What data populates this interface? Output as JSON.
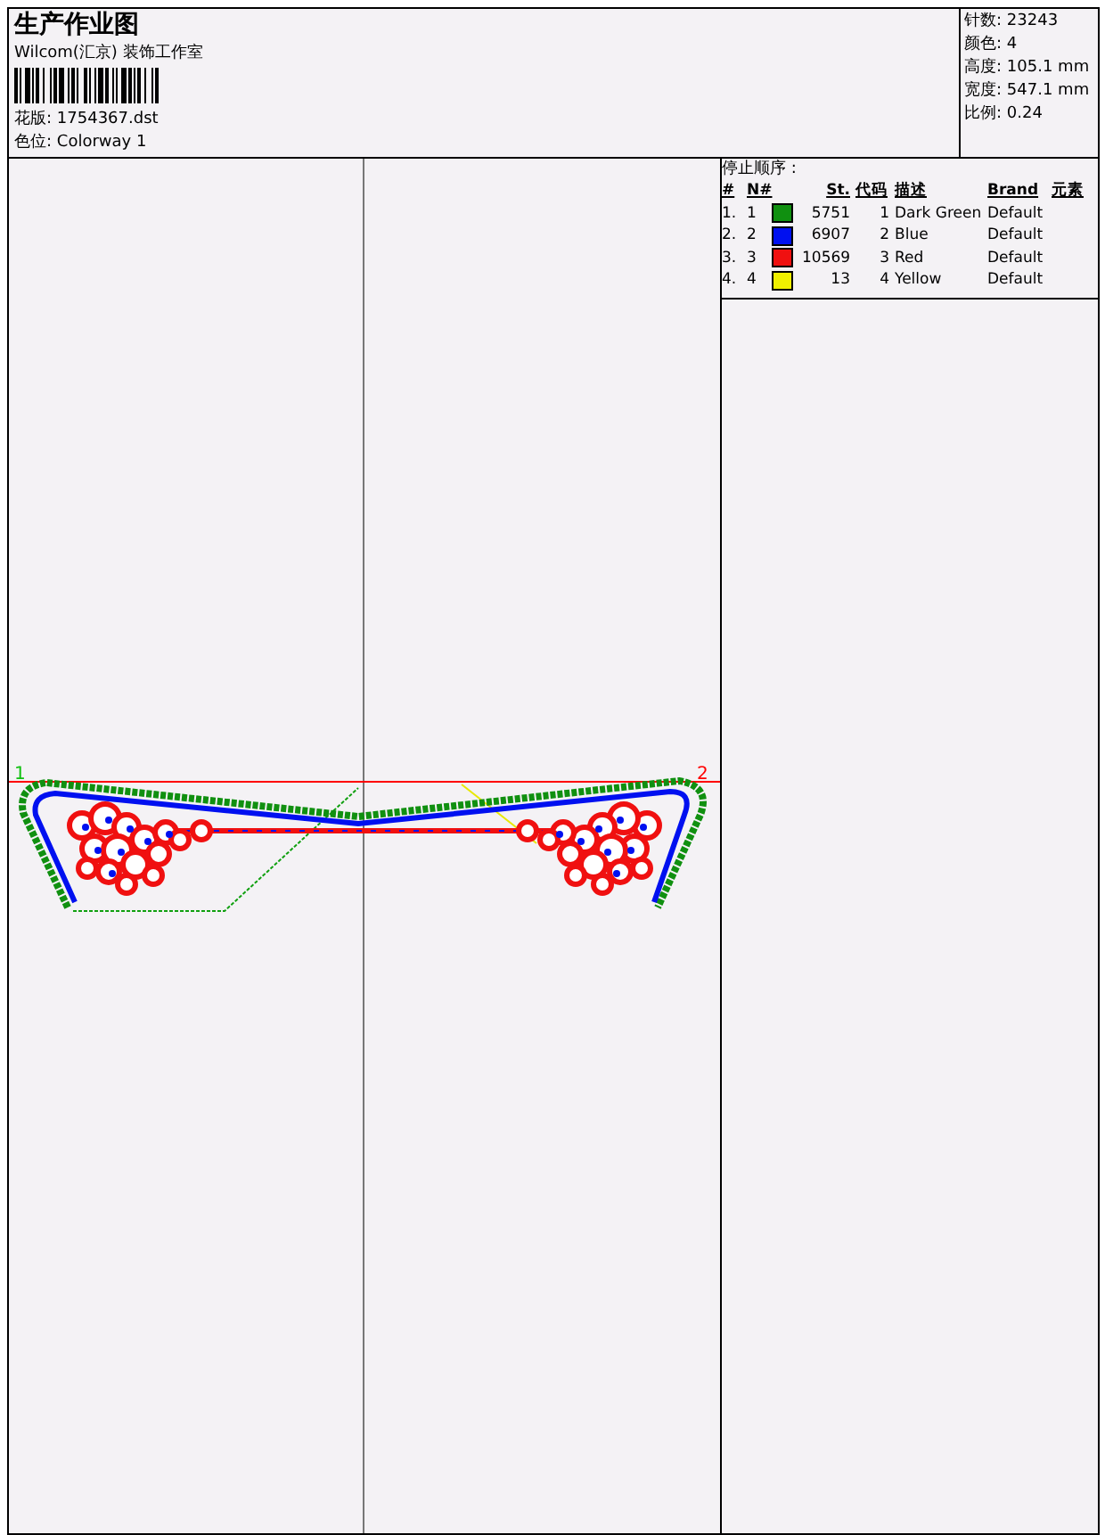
{
  "header": {
    "title": "生产作业图",
    "company": "Wilcom(汇京) 装饰工作室",
    "design_file": {
      "label": "花版:",
      "value": "1754367.dst"
    },
    "colorway": {
      "label": "色位:",
      "value": "Colorway 1"
    }
  },
  "stats": [
    {
      "label": "针数:",
      "value": "23243"
    },
    {
      "label": "颜色:",
      "value": "4"
    },
    {
      "label": "高度:",
      "value": "105.1 mm"
    },
    {
      "label": "宽度:",
      "value": "547.1 mm"
    },
    {
      "label": "比例:",
      "value": "0.24"
    }
  ],
  "canvas": {
    "start_marker": "1",
    "end_marker": "2"
  },
  "stop_sequence": {
    "title": "停止顺序 :",
    "columns": [
      "#",
      "N#",
      "St.",
      "代码",
      "描述",
      "Brand",
      "元素"
    ],
    "rows": [
      {
        "index": "1.",
        "number": "1",
        "color": "#109010",
        "stitches": "5751",
        "code": "1",
        "description": "Dark Green",
        "brand": "Default"
      },
      {
        "index": "2.",
        "number": "2",
        "color": "#0010f0",
        "stitches": "6907",
        "code": "2",
        "description": "Blue",
        "brand": "Default"
      },
      {
        "index": "3.",
        "number": "3",
        "color": "#f01010",
        "stitches": "10569",
        "code": "3",
        "description": "Red",
        "brand": "Default"
      },
      {
        "index": "4.",
        "number": "4",
        "color": "#f0f000",
        "stitches": "13",
        "code": "4",
        "description": "Yellow",
        "brand": "Default"
      }
    ]
  }
}
